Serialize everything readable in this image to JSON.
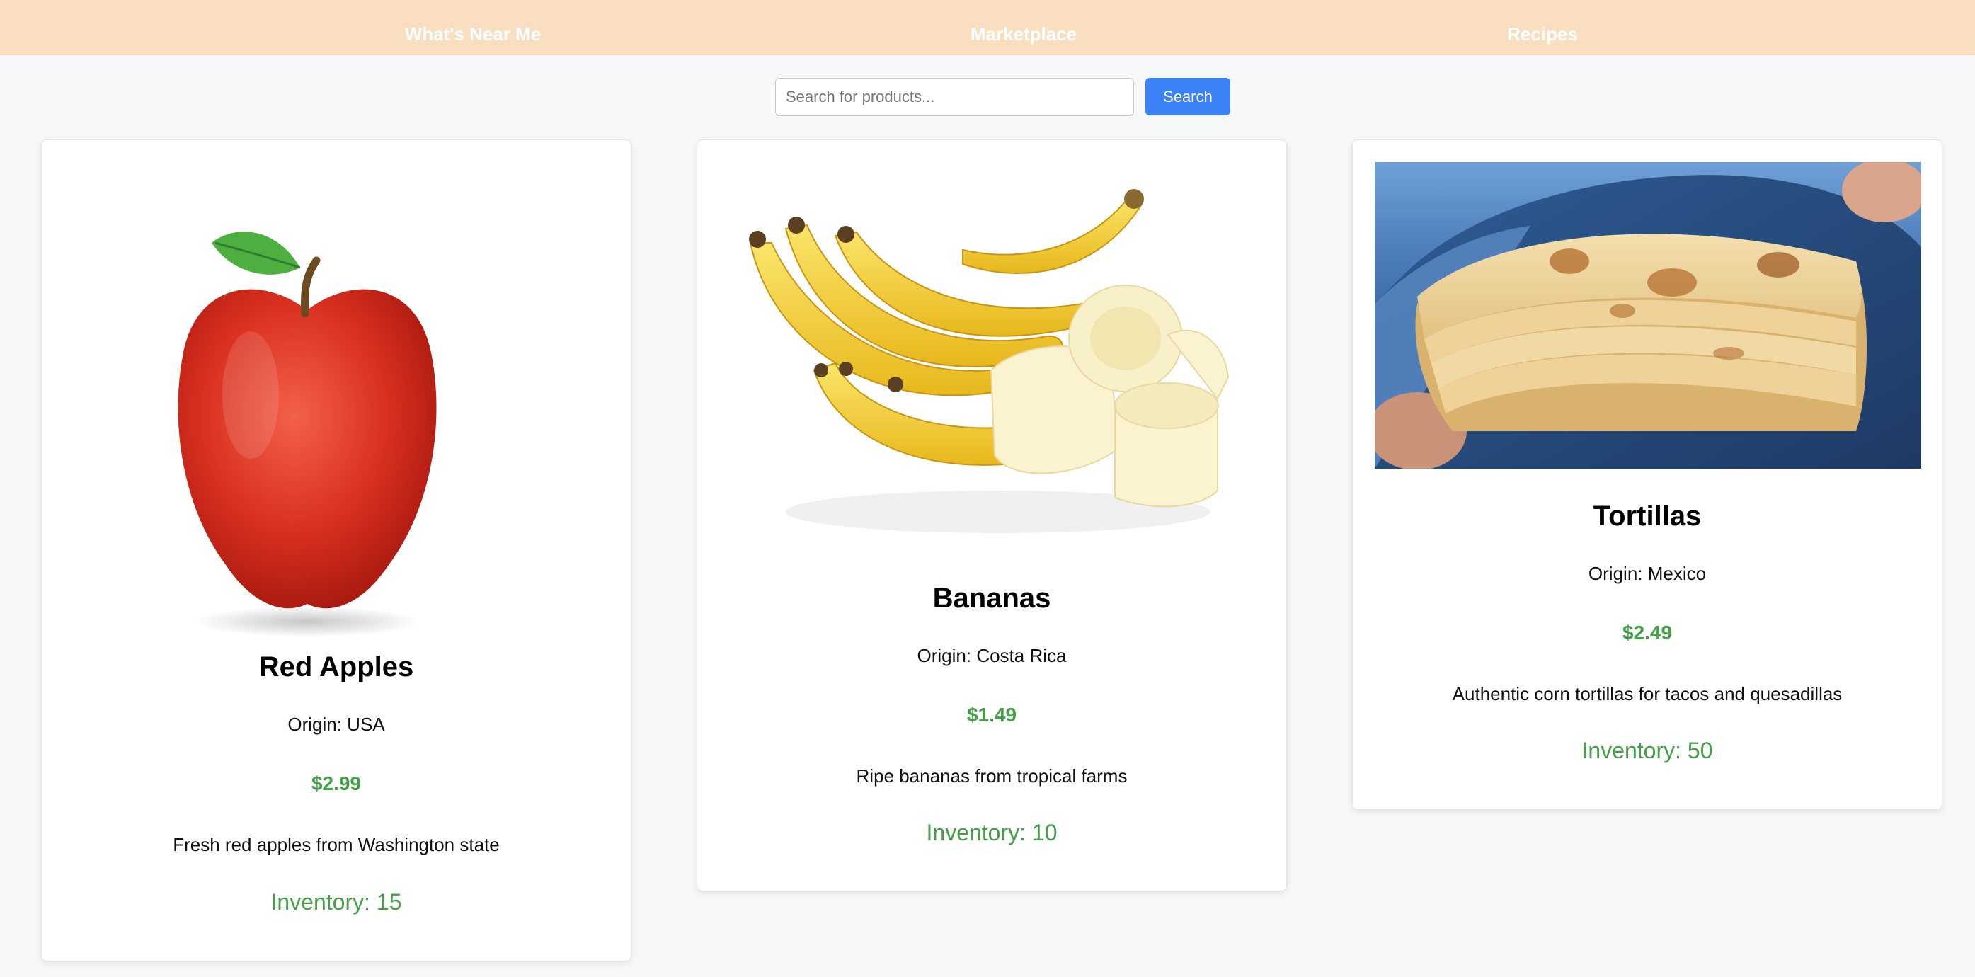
{
  "nav": {
    "items": [
      {
        "label": "What's Near Me"
      },
      {
        "label": "Marketplace"
      },
      {
        "label": "Recipes"
      }
    ]
  },
  "search": {
    "placeholder": "Search for products...",
    "value": "",
    "button_label": "Search"
  },
  "colors": {
    "nav_bg": "#f9dfc0",
    "accent_button": "#3b82f6",
    "price_green": "#43a047"
  },
  "products": [
    {
      "name": "Red Apples",
      "origin": "Origin: USA",
      "price": "$2.99",
      "description": "Fresh red apples from Washington state",
      "inventory": "Inventory: 15",
      "image": "red-apple-photo"
    },
    {
      "name": "Bananas",
      "origin": "Origin: Costa Rica",
      "price": "$1.49",
      "description": "Ripe bananas from tropical farms",
      "inventory": "Inventory: 10",
      "image": "banana-bunch-photo"
    },
    {
      "name": "Tortillas",
      "origin": "Origin: Mexico",
      "price": "$2.49",
      "description": "Authentic corn tortillas for tacos and quesadillas",
      "inventory": "Inventory: 50",
      "image": "tortilla-stack-photo"
    }
  ]
}
